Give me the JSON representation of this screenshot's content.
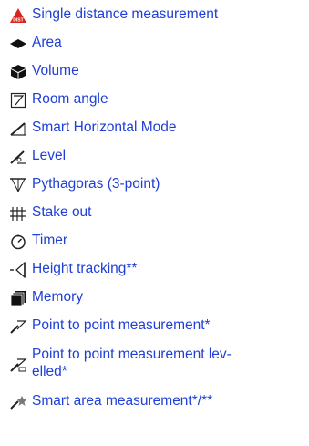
{
  "link_color": "#1f3fd6",
  "items": [
    {
      "label": "Single distance measurement",
      "icon": "single-distance-icon"
    },
    {
      "label": "Area",
      "icon": "area-icon"
    },
    {
      "label": "Volume",
      "icon": "volume-icon"
    },
    {
      "label": "Room angle",
      "icon": "room-angle-icon"
    },
    {
      "label": "Smart Horizontal Mode",
      "icon": "smart-horizontal-icon"
    },
    {
      "label": "Level",
      "icon": "level-icon"
    },
    {
      "label": "Pythagoras (3-point)",
      "icon": "pythagoras-icon"
    },
    {
      "label": "Stake out",
      "icon": "stake-out-icon"
    },
    {
      "label": "Timer",
      "icon": "timer-icon"
    },
    {
      "label": "Height tracking**",
      "icon": "height-tracking-icon"
    },
    {
      "label": "Memory",
      "icon": "memory-icon"
    },
    {
      "label": "Point to point measurement*",
      "icon": "point-to-point-icon"
    },
    {
      "label": "Point to point measurement lev-\nelled*",
      "icon": "point-to-point-levelled-icon"
    },
    {
      "label": "Smart area measurement*/**",
      "icon": "smart-area-icon"
    }
  ]
}
